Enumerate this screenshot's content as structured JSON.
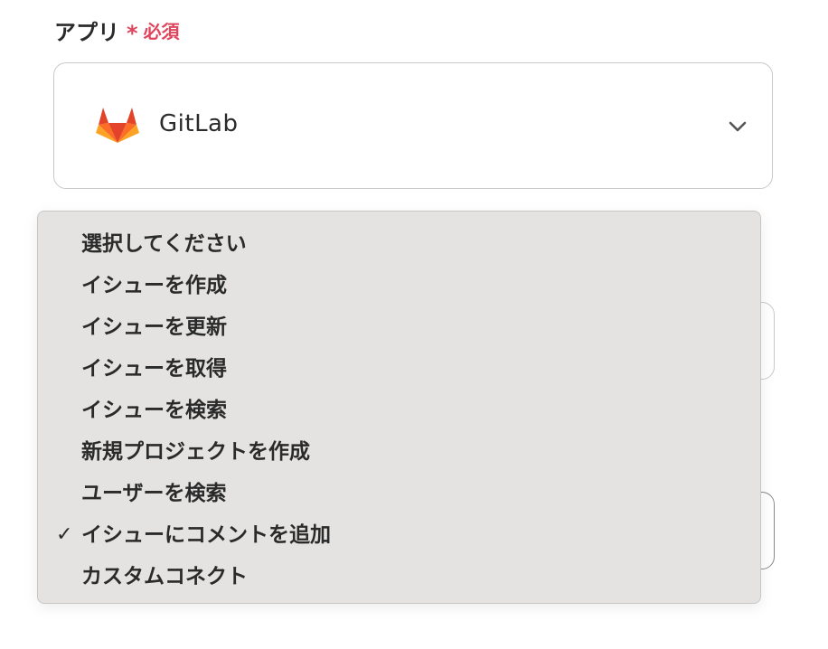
{
  "field": {
    "label": "アプリ",
    "required_mark": "*",
    "required_text": "必須"
  },
  "app_select": {
    "selected_app": "GitLab",
    "logo_icon": "gitlab-logo",
    "chevron_icon": "chevron-down-icon"
  },
  "action_dropdown": {
    "options": [
      {
        "label": "選択してください",
        "selected": false
      },
      {
        "label": "イシューを作成",
        "selected": false
      },
      {
        "label": "イシューを更新",
        "selected": false
      },
      {
        "label": "イシューを取得",
        "selected": false
      },
      {
        "label": "イシューを検索",
        "selected": false
      },
      {
        "label": "新規プロジェクトを作成",
        "selected": false
      },
      {
        "label": "ユーザーを検索",
        "selected": false
      },
      {
        "label": "イシューにコメントを追加",
        "selected": true
      },
      {
        "label": "カスタムコネクト",
        "selected": false
      }
    ],
    "check_glyph": "✓"
  },
  "colors": {
    "required": "#e0445c",
    "dropdown_bg": "#e4e3e2",
    "gitlab_orange_dark": "#e24329",
    "gitlab_orange": "#fc6d26",
    "gitlab_yellow": "#fca326"
  }
}
